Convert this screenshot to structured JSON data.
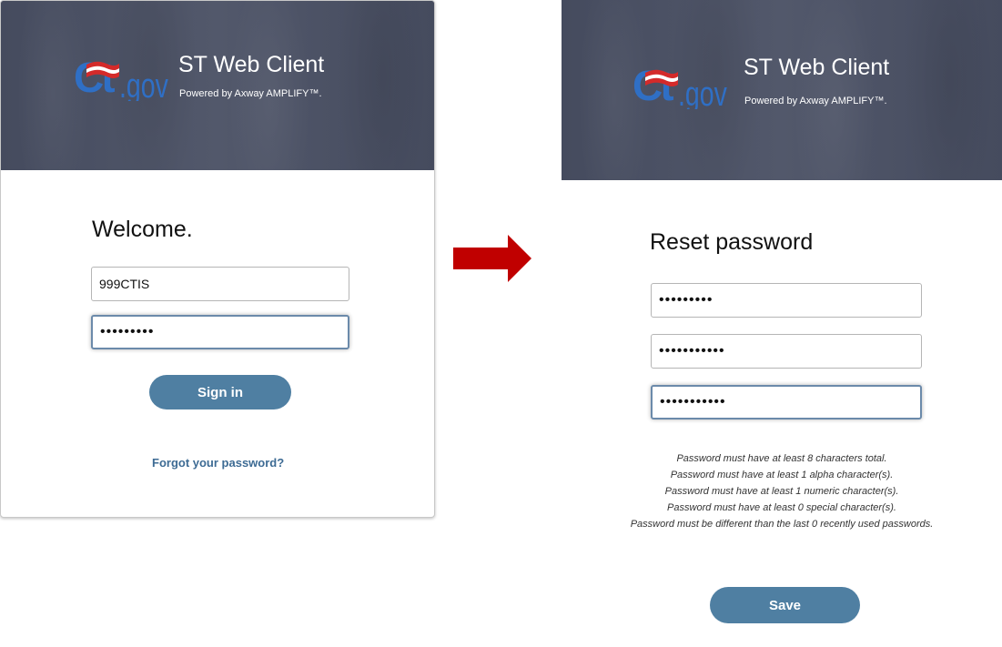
{
  "login": {
    "app_title": "ST Web Client",
    "app_subtitle": "Powered by Axway AMPLIFY™.",
    "logo_text": "ct.gov",
    "heading": "Welcome.",
    "username_value": "999CTIS",
    "password_value": "•••••••••",
    "signin_label": "Sign in",
    "forgot_link": "Forgot your password?"
  },
  "reset": {
    "app_title": "ST Web Client",
    "app_subtitle": "Powered by Axway AMPLIFY™.",
    "logo_text": "ct.gov",
    "heading": "Reset password",
    "fields": [
      "•••••••••",
      "•••••••••••",
      "•••••••••••"
    ],
    "rules": [
      "Password must have at least 8 characters total.",
      "Password must have at least 1 alpha character(s).",
      "Password must have at least 1 numeric character(s).",
      "Password must have at least 0 special character(s).",
      "Password must be different than the last 0 recently used passwords."
    ],
    "save_label": "Save"
  },
  "arrow": {
    "direction": "right"
  },
  "colors": {
    "banner": "#4b5165",
    "button": "#4f7fa2",
    "link": "#3d6b94",
    "logo_blue": "#2f6fc5",
    "logo_red": "#d42a2a",
    "arrow_red": "#c00000"
  }
}
